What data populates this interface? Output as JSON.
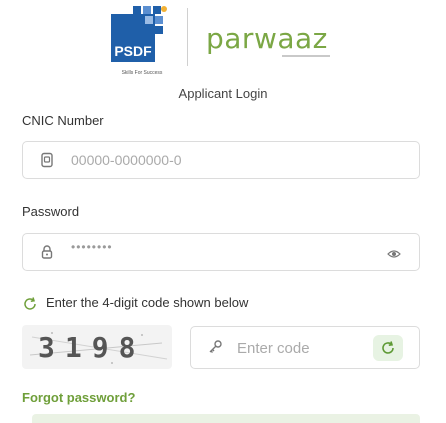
{
  "header": {
    "psdf_logo_text": "PSDF",
    "psdf_tagline": "Skills For Success",
    "brand_name": "parwaaz",
    "subtitle": "Applicant Login"
  },
  "cnic": {
    "label": "CNIC Number",
    "placeholder": "00000-0000000-0"
  },
  "password": {
    "label": "Password",
    "masked_value": "••••••••"
  },
  "captcha": {
    "instruction": "Enter the 4-digit code shown below",
    "code": "3198",
    "input_placeholder": "Enter code"
  },
  "forgot_password": "Forgot password?",
  "colors": {
    "accent_green": "#7ba745",
    "psdf_blue": "#1f5fa9",
    "border": "#dcdcdc"
  }
}
